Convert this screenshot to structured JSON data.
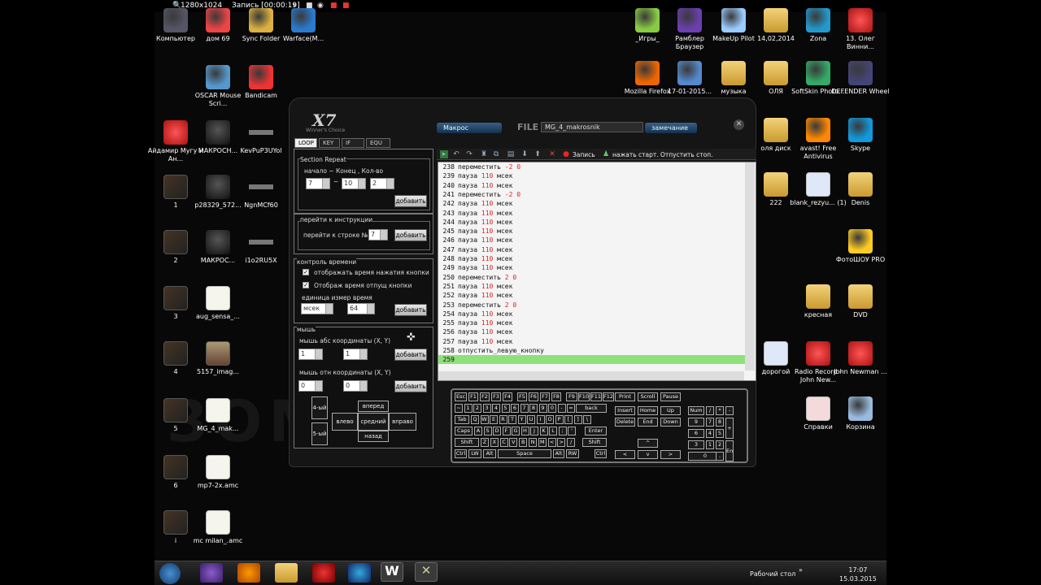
{
  "recbar": {
    "resolution": "1280x1024",
    "recording": "Запись [00:00:19]"
  },
  "watermark": "ЗОМБИ      ИКЕ",
  "desktop_left": [
    {
      "label": "Компьютер",
      "kind": "pc"
    },
    {
      "label": "дом 69",
      "kind": "power"
    },
    {
      "label": "Sync Folder",
      "kind": "sync"
    },
    {
      "label": "Warface(M...",
      "kind": "warface"
    },
    {
      "label": "OSCAR Mouse Scri...",
      "kind": "oscar"
    },
    {
      "label": "Bandicam",
      "kind": "bandicam"
    },
    {
      "label": "Айдамир Мугу и Ан...",
      "kind": "mp3"
    },
    {
      "label": "МАКРОСН...",
      "kind": "mouse"
    },
    {
      "label": "KevPuP3UYol",
      "kind": "gun"
    },
    {
      "label": "1",
      "kind": "thumb"
    },
    {
      "label": "p28329_572...",
      "kind": "mouse"
    },
    {
      "label": "NgnMCf60",
      "kind": "gun"
    },
    {
      "label": "2",
      "kind": "thumb"
    },
    {
      "label": "МАКРОС...",
      "kind": "mouse"
    },
    {
      "label": "i1o2RU5X",
      "kind": "gun"
    },
    {
      "label": "3",
      "kind": "thumb"
    },
    {
      "label": "aug_sensa_...",
      "kind": "doc"
    },
    {
      "label": "4",
      "kind": "thumb"
    },
    {
      "label": "5157_imag...",
      "kind": "cat"
    },
    {
      "label": "5",
      "kind": "thumb"
    },
    {
      "label": "MG_4_mak...",
      "kind": "doc"
    },
    {
      "label": "6",
      "kind": "thumb"
    },
    {
      "label": "mp7-2x.amc",
      "kind": "doc"
    },
    {
      "label": "i",
      "kind": "thumb"
    },
    {
      "label": "mc milan_.amc",
      "kind": "doc"
    }
  ],
  "desktop_right": [
    {
      "label": "_Игры_",
      "kind": "games"
    },
    {
      "label": "Рамблер Браузер",
      "kind": "rambler"
    },
    {
      "label": "MakeUp Pilot",
      "kind": "makeup"
    },
    {
      "label": "14,02,2014",
      "kind": "folder"
    },
    {
      "label": "Zona",
      "kind": "zona"
    },
    {
      "label": "13. Олег Винни...",
      "kind": "mp3"
    },
    {
      "label": "Mozilla Firefox",
      "kind": "firefox"
    },
    {
      "label": "17-01-2015...",
      "kind": "zip"
    },
    {
      "label": "музыка",
      "kind": "folder"
    },
    {
      "label": "ОЛЯ",
      "kind": "folder"
    },
    {
      "label": "SoftSkin Photo...",
      "kind": "softskin"
    },
    {
      "label": "DEFENDER Wheel",
      "kind": "wheel"
    },
    {
      "label": "оля диск",
      "kind": "folder"
    },
    {
      "label": "avast! Free Antivirus",
      "kind": "avast"
    },
    {
      "label": "Skype",
      "kind": "skype"
    },
    {
      "label": "222",
      "kind": "folder"
    },
    {
      "label": "blank_rezyu... (1)",
      "kind": "word"
    },
    {
      "label": "Denis",
      "kind": "folder"
    },
    {
      "label": "ФотоШОУ PRO",
      "kind": "fotoshow"
    },
    {
      "label": "кресная",
      "kind": "folder"
    },
    {
      "label": "DVD",
      "kind": "folder"
    },
    {
      "label": "дорогой",
      "kind": "word"
    },
    {
      "label": "Radio Record - John New...",
      "kind": "mp3"
    },
    {
      "label": "John Newman ...",
      "kind": "mp3"
    },
    {
      "label": "Справки",
      "kind": "pdf"
    },
    {
      "label": "Корзина",
      "kind": "bin"
    }
  ],
  "macro": {
    "logo": "X7",
    "logo_sub": "Winner's Choice",
    "dropdown_macro": "Макрос",
    "file_label": "FILE",
    "file_name": "MG_4_makrosnik",
    "dropdown_mode": "замечание",
    "close": "✕",
    "tabs": [
      "LOOP",
      "KEY",
      "IF",
      "EQU"
    ],
    "section_repeat": {
      "title": "Section Repeat",
      "caption": "начало ~ Конец , Кол-во",
      "start": "7",
      "end": "10",
      "count": "2",
      "tilde": "~",
      "add": "добавить"
    },
    "goto": {
      "title": "перейти к инструкции",
      "caption": "перейти к строке №:",
      "value": "7",
      "add": "добавить"
    },
    "time": {
      "title": "контроль времени",
      "opt1": "отображать время нажатия кнопки",
      "opt2": "Отображ время отпущ кнопки",
      "unit_caption": "единица измер время",
      "unit": "мсек",
      "unit_value": "64",
      "add": "добавить",
      "check": "✓"
    },
    "mouse": {
      "title": "мышь",
      "abs_caption": "мышь абс координаты (X, Y)",
      "abs_x": "1",
      "abs_y": "1",
      "rel_caption": "мышь отн координаты (X, Y)",
      "rel_x": "0",
      "rel_y": "0",
      "add": "добавить",
      "add2": "добавить",
      "b4": "4-ый",
      "b5": "5-ый",
      "forward": "вперед",
      "left": "влево",
      "middle": "средний",
      "right": "вправо",
      "back": "назад",
      "crosshair": "✜"
    },
    "toolbar": {
      "record": "Запись",
      "hint": "нажать старт. Отпустить стоп."
    },
    "script_rows": [
      {
        "n": "238",
        "cmd": "переместить",
        "v": "-2 0"
      },
      {
        "n": "239",
        "cmd": "пауза",
        "v": "110",
        "u": "мсек"
      },
      {
        "n": "240",
        "cmd": "пауза",
        "v": "110",
        "u": "мсек"
      },
      {
        "n": "241",
        "cmd": "переместить",
        "v": "-2 0"
      },
      {
        "n": "242",
        "cmd": "пауза",
        "v": "110",
        "u": "мсек"
      },
      {
        "n": "243",
        "cmd": "пауза",
        "v": "110",
        "u": "мсек"
      },
      {
        "n": "244",
        "cmd": "пауза",
        "v": "110",
        "u": "мсек"
      },
      {
        "n": "245",
        "cmd": "пауза",
        "v": "110",
        "u": "мсек"
      },
      {
        "n": "246",
        "cmd": "пауза",
        "v": "110",
        "u": "мсек"
      },
      {
        "n": "247",
        "cmd": "пауза",
        "v": "110",
        "u": "мсек"
      },
      {
        "n": "248",
        "cmd": "пауза",
        "v": "110",
        "u": "мсек"
      },
      {
        "n": "249",
        "cmd": "пауза",
        "v": "110",
        "u": "мсек"
      },
      {
        "n": "250",
        "cmd": "переместить",
        "v": "2 0"
      },
      {
        "n": "251",
        "cmd": "пауза",
        "v": "110",
        "u": "мсек"
      },
      {
        "n": "252",
        "cmd": "пауза",
        "v": "110",
        "u": "мсек"
      },
      {
        "n": "253",
        "cmd": "переместить",
        "v": "2 0"
      },
      {
        "n": "254",
        "cmd": "пауза",
        "v": "110",
        "u": "мсек"
      },
      {
        "n": "255",
        "cmd": "пауза",
        "v": "110",
        "u": "мсек"
      },
      {
        "n": "256",
        "cmd": "пауза",
        "v": "110",
        "u": "мсек"
      },
      {
        "n": "257",
        "cmd": "пауза",
        "v": "110",
        "u": "мсек"
      },
      {
        "n": "258",
        "cmd": "отпустить_левую_кнопку",
        "v": ""
      },
      {
        "n": "259",
        "cmd": "",
        "v": "",
        "current": true
      }
    ],
    "keyboard": {
      "rows": [
        [
          "Esc",
          "F1",
          "F2",
          "F3",
          "F4",
          "F5",
          "F6",
          "F7",
          "F8",
          "F9",
          "F10",
          "F11",
          "F12"
        ],
        [
          "~",
          "1",
          "2",
          "3",
          "4",
          "5",
          "6",
          "7",
          "8",
          "9",
          "0",
          "-",
          "=",
          "back"
        ],
        [
          "Tab",
          "Q",
          "W",
          "E",
          "R",
          "T",
          "Y",
          "U",
          "I",
          "O",
          "P",
          "[",
          "]",
          "\\"
        ],
        [
          "Caps",
          "A",
          "S",
          "D",
          "F",
          "G",
          "H",
          "J",
          "K",
          "L",
          ";",
          "'",
          "Enter"
        ],
        [
          "Shift",
          "Z",
          "X",
          "C",
          "V",
          "B",
          "N",
          "M",
          "<",
          ">",
          "/",
          "Shift"
        ],
        [
          "Ctrl",
          "LW",
          "Alt",
          "Space",
          "Alt",
          "RW",
          "Ctrl"
        ]
      ],
      "sys": [
        "Print",
        "Scroll",
        "Pause"
      ],
      "nav1": [
        "Insert",
        "Home",
        "Up"
      ],
      "nav2": [
        "Delete",
        "End",
        "Down"
      ],
      "arrows": [
        "^",
        "<",
        "v",
        ">"
      ],
      "numpad": [
        "Num",
        "/",
        "*",
        "-",
        "7",
        "8",
        "9",
        "+",
        "4",
        "5",
        "6",
        "1",
        "2",
        "3",
        "Enter",
        "0",
        "."
      ]
    }
  },
  "taskbar": {
    "tray_label": "Рабочий стол",
    "time": "17:07",
    "date": "15.03.2015",
    "chev": "»"
  }
}
